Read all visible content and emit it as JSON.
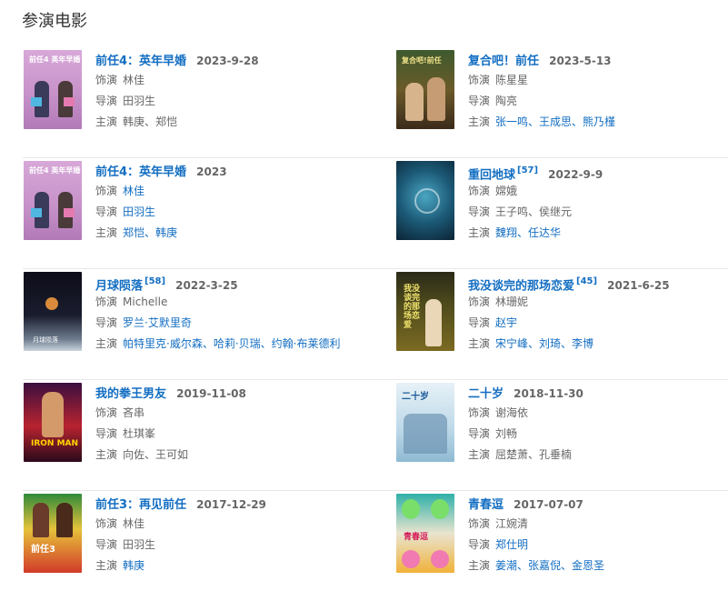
{
  "section": {
    "title": "参演电影"
  },
  "labels": {
    "role": "饰演",
    "director": "导演",
    "cast": "主演"
  },
  "rows": [
    {
      "left": {
        "title": "前任4：英年早婚",
        "ref": "",
        "date": "2023-9-28",
        "role": "林佳",
        "director": "田羽生",
        "cast": "韩庚、郑恺",
        "poster_text": "前任4 英年早婚"
      },
      "right": {
        "title": "复合吧！前任",
        "ref": "",
        "date": "2023-5-13",
        "role": "陈星星",
        "director": "陶亮",
        "cast": "张一鸣、王成思、熊乃槿",
        "poster_text": "复合吧!前任"
      }
    },
    {
      "left": {
        "title": "前任4：英年早婚",
        "ref": "",
        "date": "2023",
        "role": "林佳",
        "director": "田羽生",
        "cast": "郑恺、韩庚",
        "poster_text": "前任4 英年早婚"
      },
      "right": {
        "title": "重回地球",
        "ref": "[57]",
        "date": "2022-9-9",
        "role": "嫦娥",
        "director": "王子鸣、侯继元",
        "cast": "魏翔、任达华",
        "poster_text": ""
      }
    },
    {
      "left": {
        "title": "月球陨落",
        "ref": "[58]",
        "date": "2022-3-25",
        "role": "Michelle",
        "director": "罗兰·艾默里奇",
        "cast": "帕特里克·威尔森、哈莉·贝瑞、约翰·布莱德利",
        "poster_text": "月球陨落"
      },
      "right": {
        "title": "我没谈完的那场恋爱",
        "ref": "[45]",
        "date": "2021-6-25",
        "role": "林珊妮",
        "director": "赵宇",
        "cast": "宋宁峰、刘琦、李博",
        "poster_text": "我没谈完的那场恋爱"
      }
    },
    {
      "left": {
        "title": "我的拳王男友",
        "ref": "",
        "date": "2019-11-08",
        "role": "吝串",
        "director": "杜琪峯",
        "cast": "向佐、王可如",
        "poster_text": "IRON MAN"
      },
      "right": {
        "title": "二十岁",
        "ref": "",
        "date": "2018-11-30",
        "role": "谢海依",
        "director": "刘畅",
        "cast": "屈楚萧、孔垂楠",
        "poster_text": "二十岁"
      }
    },
    {
      "left": {
        "title": "前任3：再见前任",
        "ref": "",
        "date": "2017-12-29",
        "role": "林佳",
        "director": "田羽生",
        "cast": "韩庚",
        "poster_text": "前任3"
      },
      "right": {
        "title": "青春逗",
        "ref": "",
        "date": "2017-07-07",
        "role": "江婉清",
        "director": "郑仕明",
        "cast": "姜潮、张嘉倪、金恩圣",
        "poster_text": "青春逗"
      }
    }
  ],
  "link_state": {
    "0": {
      "left": {
        "role": false,
        "director": false,
        "cast": false
      },
      "right": {
        "role": false,
        "director": false,
        "cast": true
      }
    },
    "1": {
      "left": {
        "role": true,
        "director": true,
        "cast": true
      },
      "right": {
        "role": false,
        "director": false,
        "cast": true
      }
    },
    "2": {
      "left": {
        "role": false,
        "director": true,
        "cast": true
      },
      "right": {
        "role": false,
        "director": true,
        "cast": true
      }
    },
    "3": {
      "left": {
        "role": false,
        "director": false,
        "cast": false
      },
      "right": {
        "role": false,
        "director": false,
        "cast": false
      }
    },
    "4": {
      "left": {
        "role": false,
        "director": false,
        "cast": true
      },
      "right": {
        "role": false,
        "director": true,
        "cast": true
      }
    }
  },
  "colors": {
    "link": "#136ec2",
    "text": "#666666",
    "divider": "#e8e8e8"
  }
}
